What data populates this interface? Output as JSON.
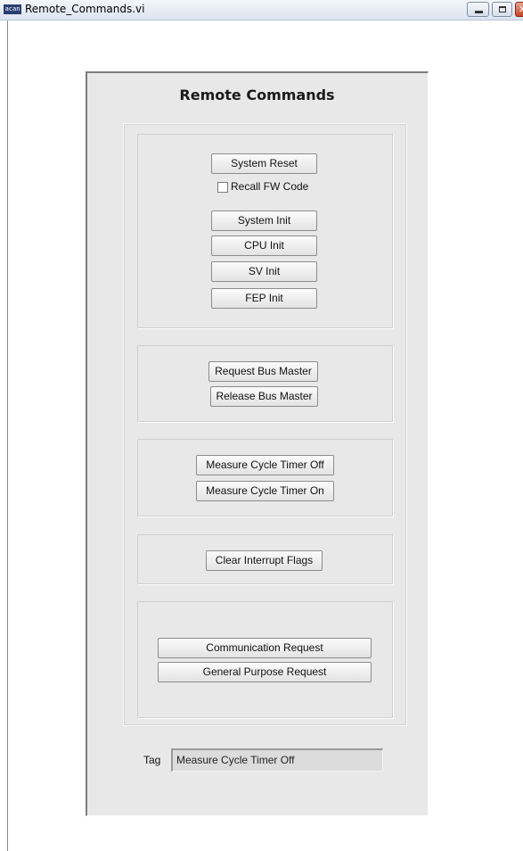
{
  "window": {
    "title": "Remote_Commands.vi",
    "app_icon_text": "acan"
  },
  "panel": {
    "title": "Remote Commands"
  },
  "system_group": {
    "system_reset": "System Reset",
    "recall_fw_label": "Recall FW Code",
    "recall_fw_checked": false,
    "system_init": "System Init",
    "cpu_init": "CPU Init",
    "sv_init": "SV Init",
    "fep_init": "FEP Init"
  },
  "bus_group": {
    "request": "Request Bus Master",
    "release": "Release Bus Master"
  },
  "timer_group": {
    "off": "Measure Cycle Timer Off",
    "on": "Measure Cycle Timer On"
  },
  "interrupt_group": {
    "clear": "Clear Interrupt Flags"
  },
  "request_group": {
    "communication": "Communication Request",
    "general": "General Purpose Request"
  },
  "tag": {
    "label": "Tag",
    "value": "Measure Cycle Timer Off"
  },
  "icons": {
    "minimize": "minimize-icon",
    "maximize": "maximize-icon",
    "close": "close-icon",
    "close_glyph": "✕"
  }
}
